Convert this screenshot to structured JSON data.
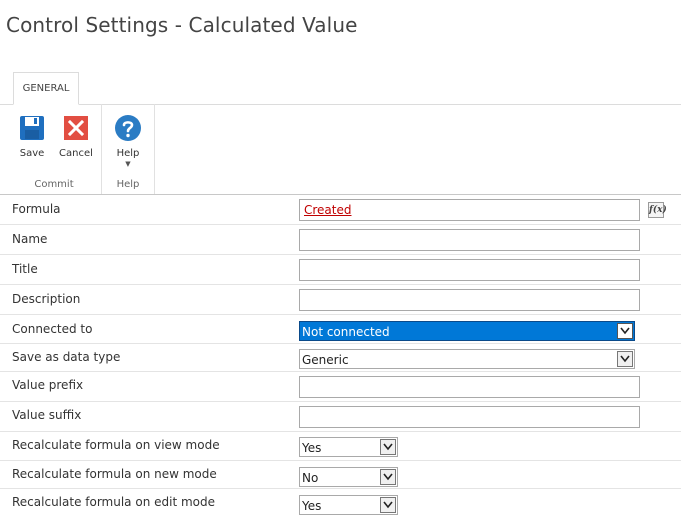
{
  "page": {
    "title": "Control Settings - Calculated Value"
  },
  "ribbon": {
    "tabs": [
      {
        "label": "GENERAL"
      }
    ],
    "groups": {
      "commit": {
        "label": "Commit",
        "save_label": "Save",
        "cancel_label": "Cancel"
      },
      "help": {
        "label": "Help",
        "help_label": "Help"
      }
    },
    "icons": {
      "save": "save-icon",
      "cancel": "cancel-icon",
      "help": "help-icon"
    },
    "colors": {
      "save": "#1f6fbf",
      "cancel": "#e24e42",
      "help": "#2b7cc4"
    }
  },
  "form": {
    "formula": {
      "label": "Formula",
      "token": "Created",
      "fx_button": "fx-icon"
    },
    "name": {
      "label": "Name",
      "value": ""
    },
    "title": {
      "label": "Title",
      "value": ""
    },
    "description": {
      "label": "Description",
      "value": ""
    },
    "connected_to": {
      "label": "Connected to",
      "selected": "Not connected"
    },
    "save_as_data_type": {
      "label": "Save as data type",
      "selected": "Generic"
    },
    "value_prefix": {
      "label": "Value prefix",
      "value": ""
    },
    "value_suffix": {
      "label": "Value suffix",
      "value": ""
    },
    "recalc_view": {
      "label": "Recalculate formula on view mode",
      "selected": "Yes"
    },
    "recalc_new": {
      "label": "Recalculate formula on new mode",
      "selected": "No"
    },
    "recalc_edit": {
      "label": "Recalculate formula on edit mode",
      "selected": "Yes"
    }
  },
  "colors": {
    "selected_highlight": "#0078d7",
    "formula_token": "#c00000"
  }
}
